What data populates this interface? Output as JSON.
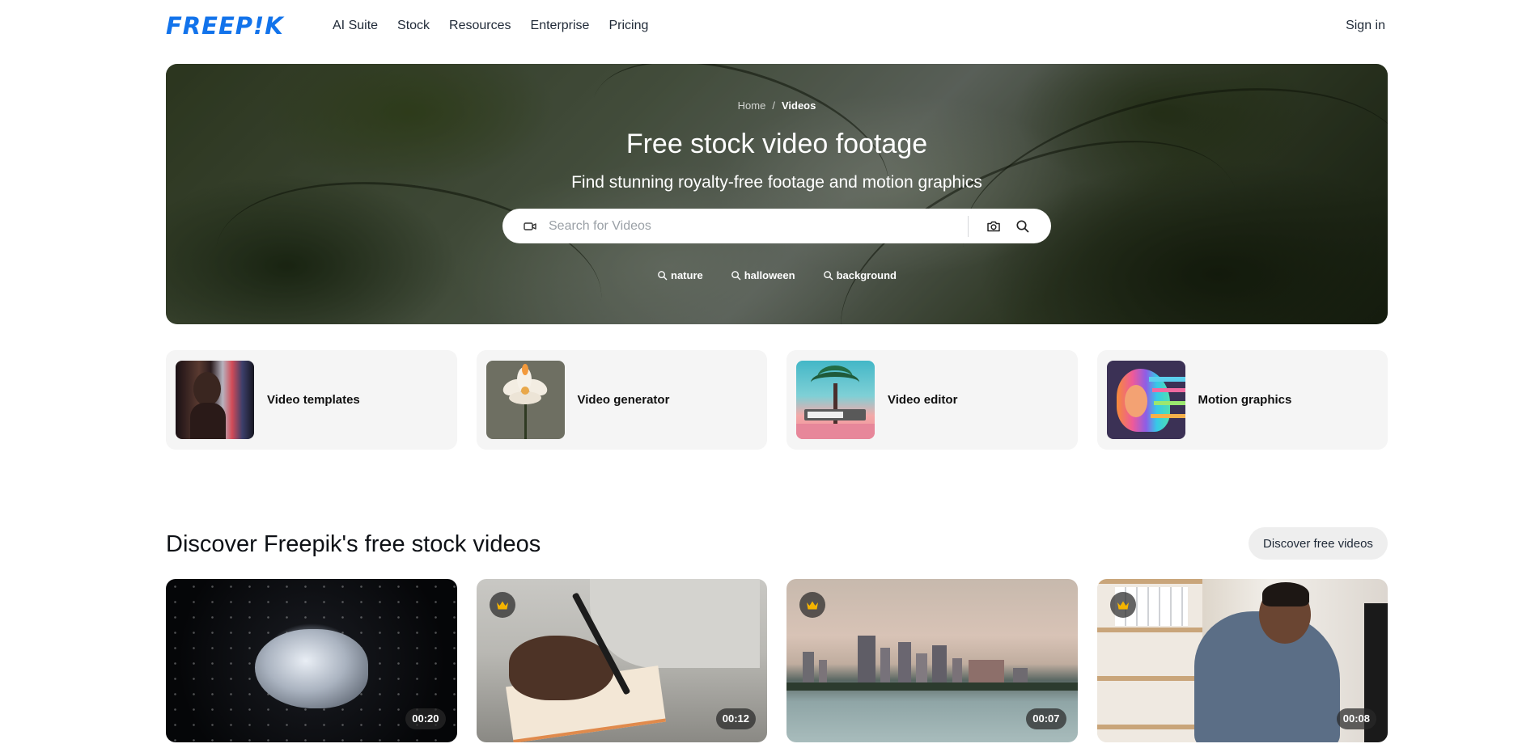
{
  "header": {
    "logo": "FREEP!K",
    "nav": [
      "AI Suite",
      "Stock",
      "Resources",
      "Enterprise",
      "Pricing"
    ],
    "signin": "Sign in"
  },
  "hero": {
    "breadcrumb": {
      "home": "Home",
      "separator": "/",
      "current": "Videos"
    },
    "title": "Free stock video footage",
    "subtitle": "Find stunning royalty-free footage and motion graphics",
    "search": {
      "placeholder": "Search for Videos",
      "value": ""
    },
    "suggestions": [
      "nature",
      "halloween",
      "background"
    ]
  },
  "categories": [
    {
      "label": "Video templates"
    },
    {
      "label": "Video generator"
    },
    {
      "label": "Video editor"
    },
    {
      "label": "Motion graphics"
    }
  ],
  "section": {
    "title": "Discover Freepik's free stock videos",
    "button": "Discover free videos"
  },
  "videos": [
    {
      "duration": "00:20",
      "premium": false
    },
    {
      "duration": "00:12",
      "premium": true
    },
    {
      "duration": "00:07",
      "premium": true
    },
    {
      "duration": "00:08",
      "premium": true
    }
  ],
  "colors": {
    "brand": "#1273eb",
    "premium_crown": "#f5b400"
  },
  "icons": [
    "video-camera-icon",
    "camera-icon",
    "search-icon",
    "crown-icon"
  ]
}
